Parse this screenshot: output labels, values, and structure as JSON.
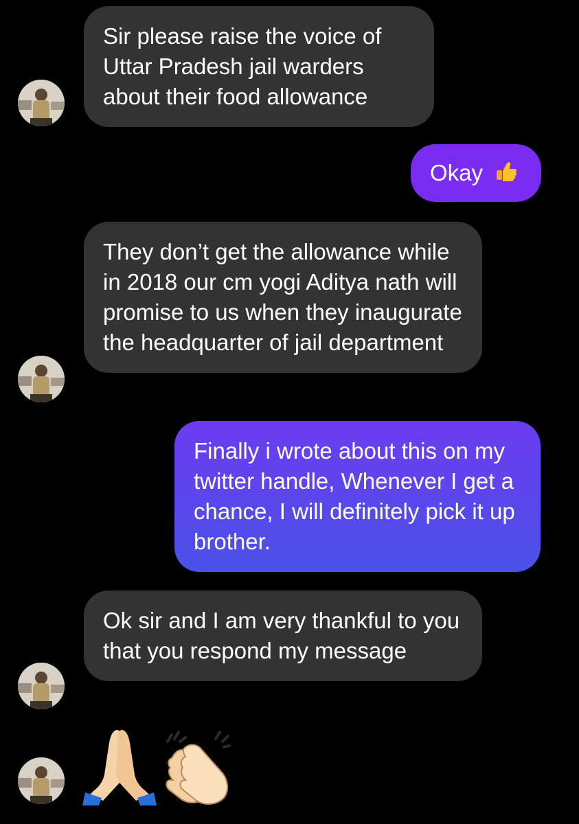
{
  "conversation": {
    "messages": [
      {
        "from": "other",
        "text": "Sir please raise the voice of Uttar Pradesh jail warders about their food allowance"
      },
      {
        "from": "me",
        "text": "Okay",
        "emoji": "thumbs-up-icon"
      },
      {
        "from": "other",
        "text": "They don’t get the allowance while in 2018 our cm yogi Aditya nath will promise to us when they inaugurate the headquarter of jail department"
      },
      {
        "from": "me",
        "text": "Finally i wrote about this on my twitter handle, Whenever I get a chance, I will definitely pick it up brother."
      },
      {
        "from": "other",
        "text": "Ok sir and I am very thankful to you that you respond my message"
      },
      {
        "from": "other",
        "emoji": [
          "folded-hands-icon",
          "clapping-hands-icon"
        ]
      }
    ]
  },
  "colors": {
    "background": "#000000",
    "incoming_bubble": "#333333",
    "outgoing_purple": "#7a2bf0",
    "outgoing_gradient_top": "#6b3cf0",
    "outgoing_gradient_bottom": "#4a52e8",
    "text": "#ffffff"
  }
}
